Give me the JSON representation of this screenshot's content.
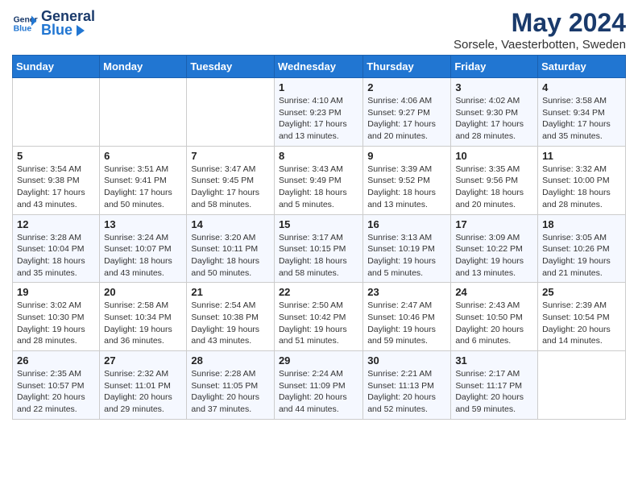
{
  "logo": {
    "general": "General",
    "blue": "Blue"
  },
  "title": "May 2024",
  "subtitle": "Sorsele, Vaesterbotten, Sweden",
  "days_of_week": [
    "Sunday",
    "Monday",
    "Tuesday",
    "Wednesday",
    "Thursday",
    "Friday",
    "Saturday"
  ],
  "weeks": [
    [
      {
        "day": "",
        "info": ""
      },
      {
        "day": "",
        "info": ""
      },
      {
        "day": "",
        "info": ""
      },
      {
        "day": "1",
        "info": "Sunrise: 4:10 AM\nSunset: 9:23 PM\nDaylight: 17 hours\nand 13 minutes."
      },
      {
        "day": "2",
        "info": "Sunrise: 4:06 AM\nSunset: 9:27 PM\nDaylight: 17 hours\nand 20 minutes."
      },
      {
        "day": "3",
        "info": "Sunrise: 4:02 AM\nSunset: 9:30 PM\nDaylight: 17 hours\nand 28 minutes."
      },
      {
        "day": "4",
        "info": "Sunrise: 3:58 AM\nSunset: 9:34 PM\nDaylight: 17 hours\nand 35 minutes."
      }
    ],
    [
      {
        "day": "5",
        "info": "Sunrise: 3:54 AM\nSunset: 9:38 PM\nDaylight: 17 hours\nand 43 minutes."
      },
      {
        "day": "6",
        "info": "Sunrise: 3:51 AM\nSunset: 9:41 PM\nDaylight: 17 hours\nand 50 minutes."
      },
      {
        "day": "7",
        "info": "Sunrise: 3:47 AM\nSunset: 9:45 PM\nDaylight: 17 hours\nand 58 minutes."
      },
      {
        "day": "8",
        "info": "Sunrise: 3:43 AM\nSunset: 9:49 PM\nDaylight: 18 hours\nand 5 minutes."
      },
      {
        "day": "9",
        "info": "Sunrise: 3:39 AM\nSunset: 9:52 PM\nDaylight: 18 hours\nand 13 minutes."
      },
      {
        "day": "10",
        "info": "Sunrise: 3:35 AM\nSunset: 9:56 PM\nDaylight: 18 hours\nand 20 minutes."
      },
      {
        "day": "11",
        "info": "Sunrise: 3:32 AM\nSunset: 10:00 PM\nDaylight: 18 hours\nand 28 minutes."
      }
    ],
    [
      {
        "day": "12",
        "info": "Sunrise: 3:28 AM\nSunset: 10:04 PM\nDaylight: 18 hours\nand 35 minutes."
      },
      {
        "day": "13",
        "info": "Sunrise: 3:24 AM\nSunset: 10:07 PM\nDaylight: 18 hours\nand 43 minutes."
      },
      {
        "day": "14",
        "info": "Sunrise: 3:20 AM\nSunset: 10:11 PM\nDaylight: 18 hours\nand 50 minutes."
      },
      {
        "day": "15",
        "info": "Sunrise: 3:17 AM\nSunset: 10:15 PM\nDaylight: 18 hours\nand 58 minutes."
      },
      {
        "day": "16",
        "info": "Sunrise: 3:13 AM\nSunset: 10:19 PM\nDaylight: 19 hours\nand 5 minutes."
      },
      {
        "day": "17",
        "info": "Sunrise: 3:09 AM\nSunset: 10:22 PM\nDaylight: 19 hours\nand 13 minutes."
      },
      {
        "day": "18",
        "info": "Sunrise: 3:05 AM\nSunset: 10:26 PM\nDaylight: 19 hours\nand 21 minutes."
      }
    ],
    [
      {
        "day": "19",
        "info": "Sunrise: 3:02 AM\nSunset: 10:30 PM\nDaylight: 19 hours\nand 28 minutes."
      },
      {
        "day": "20",
        "info": "Sunrise: 2:58 AM\nSunset: 10:34 PM\nDaylight: 19 hours\nand 36 minutes."
      },
      {
        "day": "21",
        "info": "Sunrise: 2:54 AM\nSunset: 10:38 PM\nDaylight: 19 hours\nand 43 minutes."
      },
      {
        "day": "22",
        "info": "Sunrise: 2:50 AM\nSunset: 10:42 PM\nDaylight: 19 hours\nand 51 minutes."
      },
      {
        "day": "23",
        "info": "Sunrise: 2:47 AM\nSunset: 10:46 PM\nDaylight: 19 hours\nand 59 minutes."
      },
      {
        "day": "24",
        "info": "Sunrise: 2:43 AM\nSunset: 10:50 PM\nDaylight: 20 hours\nand 6 minutes."
      },
      {
        "day": "25",
        "info": "Sunrise: 2:39 AM\nSunset: 10:54 PM\nDaylight: 20 hours\nand 14 minutes."
      }
    ],
    [
      {
        "day": "26",
        "info": "Sunrise: 2:35 AM\nSunset: 10:57 PM\nDaylight: 20 hours\nand 22 minutes."
      },
      {
        "day": "27",
        "info": "Sunrise: 2:32 AM\nSunset: 11:01 PM\nDaylight: 20 hours\nand 29 minutes."
      },
      {
        "day": "28",
        "info": "Sunrise: 2:28 AM\nSunset: 11:05 PM\nDaylight: 20 hours\nand 37 minutes."
      },
      {
        "day": "29",
        "info": "Sunrise: 2:24 AM\nSunset: 11:09 PM\nDaylight: 20 hours\nand 44 minutes."
      },
      {
        "day": "30",
        "info": "Sunrise: 2:21 AM\nSunset: 11:13 PM\nDaylight: 20 hours\nand 52 minutes."
      },
      {
        "day": "31",
        "info": "Sunrise: 2:17 AM\nSunset: 11:17 PM\nDaylight: 20 hours\nand 59 minutes."
      },
      {
        "day": "",
        "info": ""
      }
    ]
  ]
}
